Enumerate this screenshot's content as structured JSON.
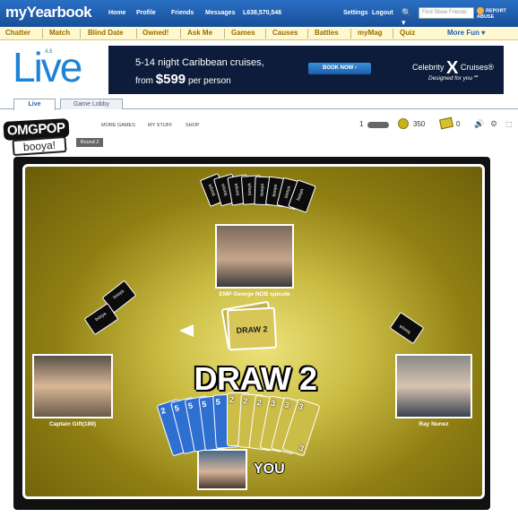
{
  "topbar": {
    "logo": "myYearbook",
    "nav": [
      "Home",
      "Profile",
      "Friends",
      "Messages"
    ],
    "counter": "L638,570,546",
    "settings": "Settings",
    "logout": "Logout",
    "search_placeholder": "Find Sbow Friends",
    "report_abuse": "REPORT ABUSE"
  },
  "subnav": {
    "items": [
      "Chatter",
      "Match",
      "Blind Date",
      "Owned!",
      "Ask Me",
      "Games",
      "Causes",
      "Battles",
      "myMag",
      "Quiz"
    ],
    "more": "More Fun ▾"
  },
  "live_logo": "Live",
  "live_small": "4.5",
  "ad": {
    "line1": "5-14 night Caribbean cruises,",
    "line2_prefix": "from",
    "price": "$599",
    "line2_suffix": "per person",
    "button": "BOOK NOW ›",
    "brand": "Celebrity",
    "brand_x": "X",
    "brand_suffix": "Cruises®",
    "tagline": "Designed for you℠"
  },
  "tabs": [
    "Live",
    "Game Lobby"
  ],
  "game": {
    "omgpop": "OMGPOP",
    "booya": "booya!",
    "nav": [
      "MORE GAMES",
      "MY STUFF",
      "SHOP"
    ],
    "round": "Round 2",
    "stat_one": "1",
    "coins": "350",
    "tickets": "0",
    "sound_icon": "speaker-icon",
    "draw_pile": "DRAW 2",
    "banner": "DRAW 2",
    "you": "YOU",
    "players": {
      "top": "EMP George NOB spicule",
      "left": "Captain Gift(189)",
      "right": "Ray Nunez"
    },
    "hand": [
      {
        "color": "#2f6fd0",
        "num": "2"
      },
      {
        "color": "#2f6fd0",
        "num": "5"
      },
      {
        "color": "#2f6fd0",
        "num": "5"
      },
      {
        "color": "#2f6fd0",
        "num": "5"
      },
      {
        "color": "#2f6fd0",
        "num": "5"
      },
      {
        "color": "#cbbd48",
        "num": "2"
      },
      {
        "color": "#cbbd48",
        "num": "2"
      },
      {
        "color": "#cbbd48",
        "num": "2"
      },
      {
        "color": "#cbbd48",
        "num": "3"
      },
      {
        "color": "#cbbd48",
        "num": "3"
      },
      {
        "color": "#cbbd48",
        "num": "3"
      }
    ]
  },
  "colors": {
    "topbar": "#1f5fb0",
    "subnav_bg": "#fdf8d0",
    "table_felt": "#c9bb42",
    "ad_bg": "#0c1c3a"
  }
}
